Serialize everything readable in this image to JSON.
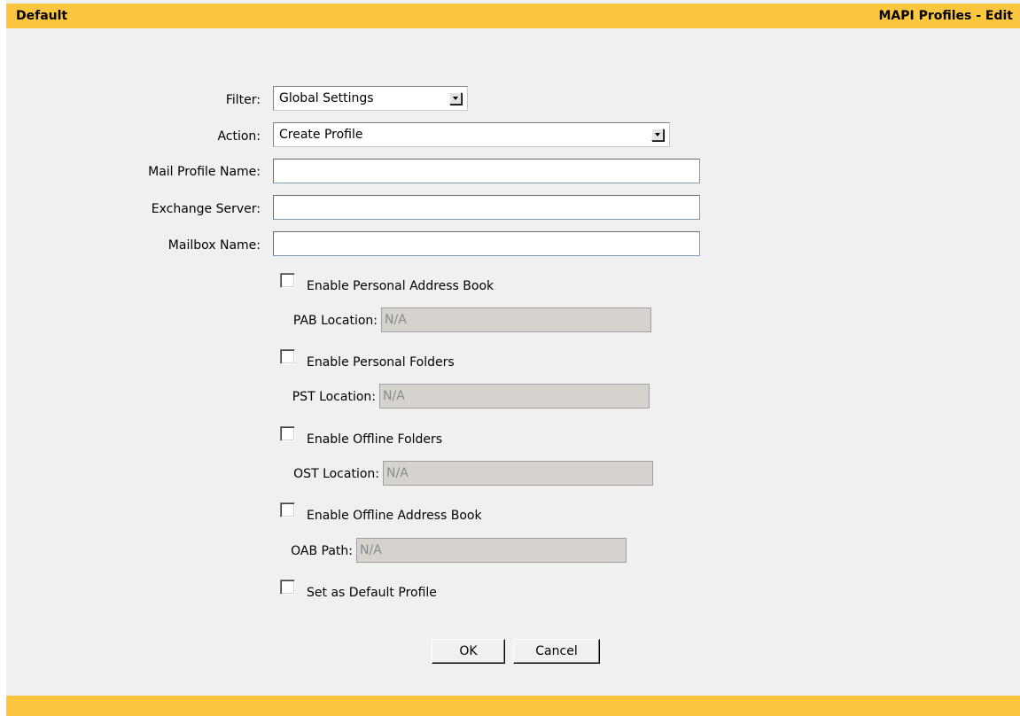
{
  "header": {
    "left_title": "Default",
    "right_title": "MAPI Profiles - Edit"
  },
  "form": {
    "filter": {
      "label": "Filter:",
      "value": "Global Settings"
    },
    "action": {
      "label": "Action:",
      "value": "Create Profile"
    },
    "mail_profile_name": {
      "label": "Mail Profile Name:",
      "value": ""
    },
    "exchange_server": {
      "label": "Exchange Server:",
      "value": ""
    },
    "mailbox_name": {
      "label": "Mailbox Name:",
      "value": ""
    },
    "enable_pab": {
      "label": "Enable Personal Address Book",
      "checked": false
    },
    "pab_location": {
      "label": "PAB Location:",
      "value": "N/A"
    },
    "enable_personal_folders": {
      "label": "Enable Personal Folders",
      "checked": false
    },
    "pst_location": {
      "label": "PST Location:",
      "value": "N/A"
    },
    "enable_offline_folders": {
      "label": "Enable Offline Folders",
      "checked": false
    },
    "ost_location": {
      "label": "OST Location:",
      "value": "N/A"
    },
    "enable_oab": {
      "label": "Enable Offline Address Book",
      "checked": false
    },
    "oab_path": {
      "label": "OAB Path:",
      "value": "N/A"
    },
    "set_default": {
      "label": "Set as Default Profile",
      "checked": false
    }
  },
  "buttons": {
    "ok": "OK",
    "cancel": "Cancel"
  },
  "colors": {
    "header_bar": "#fcc73f",
    "panel_background": "#f0f0f0",
    "disabled_field": "#d6d3ce"
  }
}
